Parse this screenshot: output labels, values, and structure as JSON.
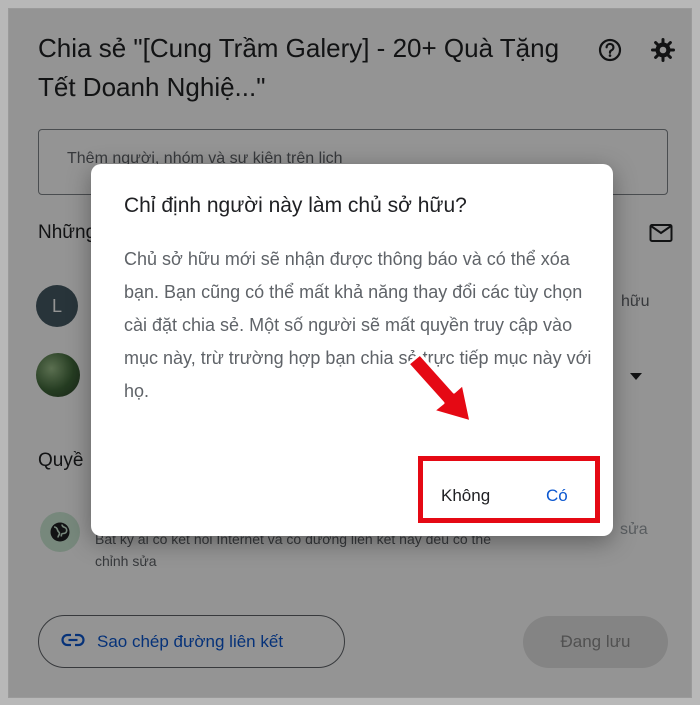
{
  "share_dialog": {
    "title": "Chia sẻ \"[Cung Trầm Galery] - 20+ Quà Tặng Tết Doanh Nghiệ...\"",
    "add_people_placeholder": "Thêm người, nhóm và sự kiện trên lịch",
    "people_section_label": "Những",
    "people": [
      {
        "initial": "L",
        "role_tail": "hữu"
      },
      {
        "initial": ""
      }
    ],
    "general_access_label": "Quyề",
    "access_description": "Bất kỳ ai có kết nối Internet và có đường liên kết này đều có thể chỉnh sửa",
    "edit_tail": "sửa",
    "copy_link_label": "Sao chép đường liên kết",
    "saving_label": "Đang lưu",
    "icons": [
      "help-icon",
      "gear-icon",
      "mail-icon",
      "globe-icon",
      "link-icon"
    ]
  },
  "confirm_dialog": {
    "title": "Chỉ định người này làm chủ sở hữu?",
    "body": "Chủ sở hữu mới sẽ nhận được thông báo và có thể xóa bạn. Bạn cũng có thể mất khả năng thay đổi các tùy chọn cài đặt chia sẻ. Một số người sẽ mất quyền truy cập vào mục này, trừ trường hợp bạn chia sẻ trực tiếp mục này với họ.",
    "no_label": "Không",
    "yes_label": "Có"
  },
  "annotation": {
    "highlight_color": "#e50914"
  },
  "colors": {
    "accent": "#0b57d0",
    "text": "#202124",
    "muted": "#5f6368"
  }
}
